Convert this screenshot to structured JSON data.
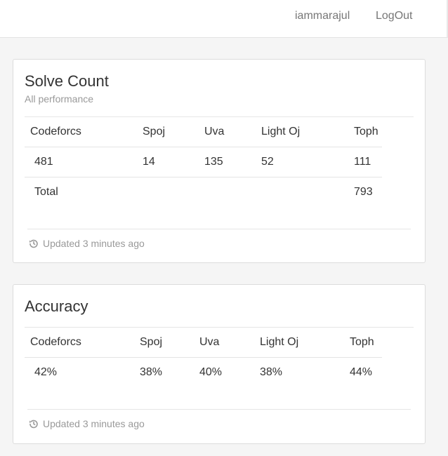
{
  "navbar": {
    "user": "iammarajul",
    "logout": "LogOut"
  },
  "solve_count": {
    "title": "Solve Count",
    "subtitle": "All performance",
    "headers": [
      "Codeforcs",
      "Spoj",
      "Uva",
      "Light Oj",
      "Toph"
    ],
    "values": [
      "481",
      "14",
      "135",
      "52",
      "111"
    ],
    "total_label": "Total",
    "total_value": "793",
    "footer": "Updated 3 minutes ago",
    "footer_icon": "history-icon"
  },
  "accuracy": {
    "title": "Accuracy",
    "headers": [
      "Codeforcs",
      "Spoj",
      "Uva",
      "Light Oj",
      "Toph"
    ],
    "values": [
      "42%",
      "38%",
      "40%",
      "38%",
      "44%"
    ],
    "footer": "Updated 3 minutes ago",
    "footer_icon": "history-icon"
  }
}
